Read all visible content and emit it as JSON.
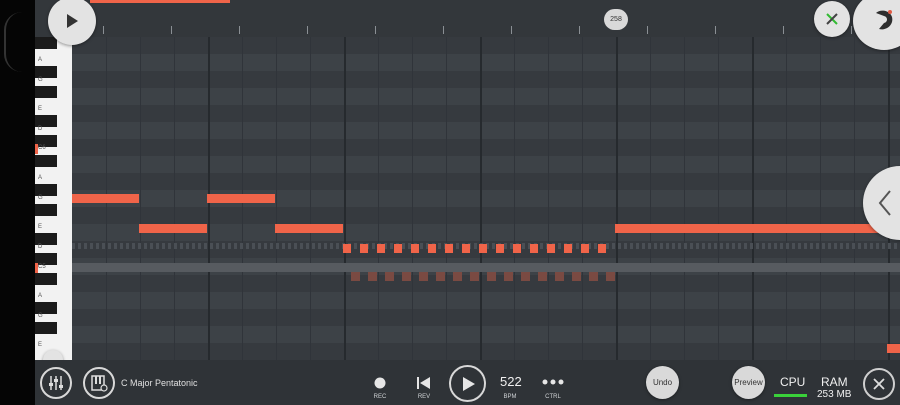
{
  "timeline": {
    "bar_marker": "258"
  },
  "keyboard": {
    "labels": [
      "A",
      "G",
      "E",
      "D",
      "C6",
      "A",
      "G",
      "E",
      "D",
      "C5",
      "A",
      "G",
      "E"
    ]
  },
  "bottom": {
    "scale_name": "C Major Pentatonic",
    "rec_label": "REC",
    "rev_label": "REV",
    "bpm_value": "522",
    "bpm_label": "BPM",
    "ctrl_label": "CTRL",
    "undo_label": "Undo",
    "preview_label": "Preview",
    "cpu_label": "CPU",
    "ram_label": "RAM",
    "ram_value": "253 MB"
  },
  "colors": {
    "note": "#f06449",
    "cpu_meter": "#3ad13a",
    "background": "#3a3f44"
  },
  "icons": [
    "play-icon",
    "close-x-icon",
    "fl-logo-icon",
    "chevron-left-icon",
    "mixer-icon",
    "piano-settings-icon",
    "record-icon",
    "rewind-icon",
    "transport-play-icon",
    "more-dots-icon",
    "close-icon"
  ]
}
